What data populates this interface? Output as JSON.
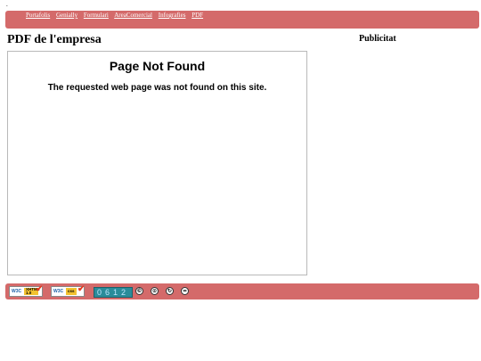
{
  "topbar": {
    "marker": ".",
    "nav": [
      {
        "label": "Portafolis"
      },
      {
        "label": "Genially"
      },
      {
        "label": "Formulari"
      },
      {
        "label": "AreaComercial"
      },
      {
        "label": "Infografies"
      },
      {
        "label": "PDF"
      }
    ]
  },
  "main": {
    "heading": "PDF de l'empresa",
    "frame": {
      "title": "Page Not Found",
      "message": "The requested web page was not found on this site."
    }
  },
  "sidebar": {
    "heading": "Publicitat"
  },
  "footer": {
    "badges": [
      {
        "w3c": "W3C",
        "kind": "XHTML 1.0",
        "icon": "check-icon"
      },
      {
        "w3c": "W3C",
        "kind": "css",
        "icon": "check-icon"
      }
    ],
    "counter": "0612",
    "cc_icons": [
      {
        "name": "cc-icon",
        "glyph": "©"
      },
      {
        "name": "by-icon",
        "glyph": "⊙"
      },
      {
        "name": "sa-icon",
        "glyph": "↻"
      },
      {
        "name": "nd-icon",
        "glyph": "="
      }
    ]
  },
  "colors": {
    "bar": "#d46a6a",
    "link": "#ffffff",
    "counter_bg": "#2a8c9a"
  }
}
